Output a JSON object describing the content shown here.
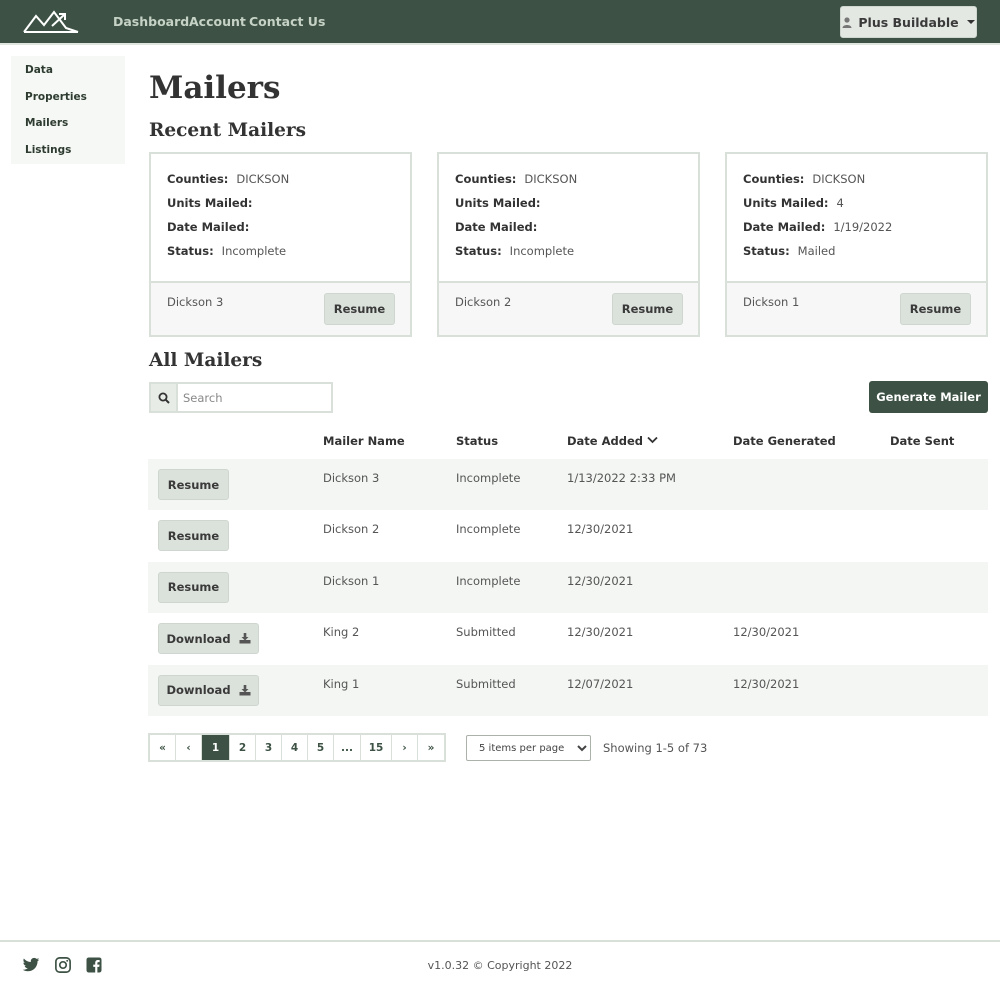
{
  "navbar": {
    "links": [
      "Dashboard",
      "Account",
      "Contact Us"
    ],
    "user_label": "Plus Buildable"
  },
  "sidebar": {
    "items": [
      "Data",
      "Properties",
      "Mailers",
      "Listings"
    ]
  },
  "page": {
    "title": "Mailers",
    "recent_title": "Recent Mailers",
    "all_title": "All Mailers"
  },
  "card_labels": {
    "counties": "Counties:",
    "units": "Units Mailed:",
    "date": "Date Mailed:",
    "status": "Status:"
  },
  "recent": [
    {
      "counties": "DICKSON",
      "units": "",
      "date": "",
      "status": "Incomplete",
      "name": "Dickson 3",
      "action": "Resume"
    },
    {
      "counties": "DICKSON",
      "units": "",
      "date": "",
      "status": "Incomplete",
      "name": "Dickson 2",
      "action": "Resume"
    },
    {
      "counties": "DICKSON",
      "units": "4",
      "date": "1/19/2022",
      "status": "Mailed",
      "name": "Dickson 1",
      "action": "Resume"
    }
  ],
  "search": {
    "placeholder": "Search"
  },
  "generate_label": "Generate Mailer",
  "table": {
    "headers": [
      "Mailer Name",
      "Status",
      "Date Added",
      "Date Generated",
      "Date Sent"
    ],
    "rows": [
      {
        "action": "Resume",
        "name": "Dickson 3",
        "status": "Incomplete",
        "added": "1/13/2022 2:33 PM",
        "generated": "",
        "sent": ""
      },
      {
        "action": "Resume",
        "name": "Dickson 2",
        "status": "Incomplete",
        "added": "12/30/2021",
        "generated": "",
        "sent": ""
      },
      {
        "action": "Resume",
        "name": "Dickson 1",
        "status": "Incomplete",
        "added": "12/30/2021",
        "generated": "",
        "sent": ""
      },
      {
        "action": "Download",
        "name": "King 2",
        "status": "Submitted",
        "added": "12/30/2021",
        "generated": "12/30/2021",
        "sent": ""
      },
      {
        "action": "Download",
        "name": "King 1",
        "status": "Submitted",
        "added": "12/07/2021",
        "generated": "12/30/2021",
        "sent": ""
      }
    ]
  },
  "pagination": {
    "first": "«",
    "prev": "‹",
    "pages": [
      "1",
      "2",
      "3",
      "4",
      "5",
      "...",
      "15"
    ],
    "active": "1",
    "next": "›",
    "last": "»",
    "per_page": "5 items per page",
    "showing": "Showing 1-5 of 73"
  },
  "footer": {
    "copyright": "v1.0.32 © Copyright 2022",
    "icons": [
      "twitter-icon",
      "instagram-icon",
      "facebook-icon"
    ]
  },
  "colors": {
    "brand": "#3d5244",
    "row_alt": "#f3f6f3",
    "button": "#dbe1db"
  }
}
